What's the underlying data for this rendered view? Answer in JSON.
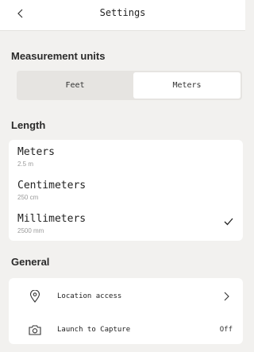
{
  "header": {
    "title": "Settings",
    "back_icon": "chevron-left-icon"
  },
  "measurement": {
    "heading": "Measurement units",
    "options": [
      "Feet",
      "Meters"
    ],
    "selected": "Meters"
  },
  "length": {
    "heading": "Length",
    "items": [
      {
        "label": "Meters",
        "value": "2.5 m",
        "selected": false
      },
      {
        "label": "Centimeters",
        "value": "250 cm",
        "selected": false
      },
      {
        "label": "Millimeters",
        "value": "2500 mm",
        "selected": true
      }
    ],
    "check_icon": "checkmark-icon"
  },
  "general": {
    "heading": "General",
    "items": [
      {
        "label": "Location access",
        "icon": "location-pin-icon",
        "trail": "chevron-right-icon",
        "value": ""
      },
      {
        "label": "Launch to Capture",
        "icon": "camera-icon",
        "trail": "",
        "value": "Off"
      }
    ]
  }
}
